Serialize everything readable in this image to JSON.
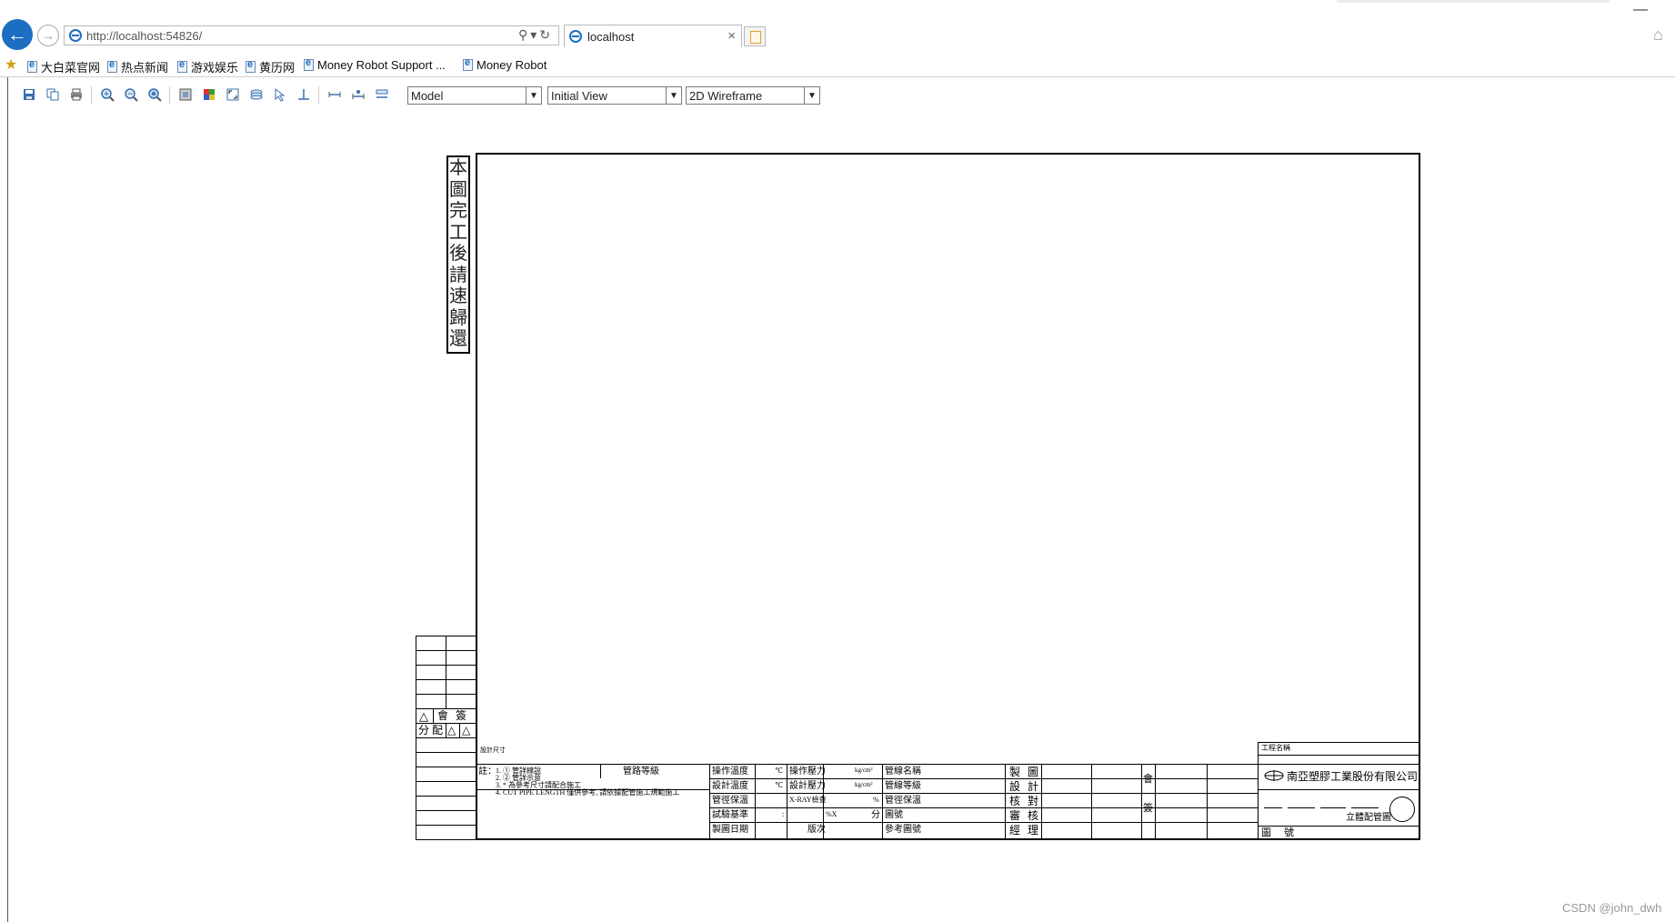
{
  "browser": {
    "url": "http://localhost:54826/",
    "tab_title": "localhost",
    "favorites": [
      "大白菜官网",
      "热点新闻",
      "游戏娱乐",
      "黄历网",
      "Money Robot Support ...",
      "Money Robot"
    ]
  },
  "cad_viewer": {
    "toolbar_icons": [
      "save-icon",
      "copy-icon",
      "print-icon",
      "zoom-in-icon",
      "zoom-out-icon",
      "zoom-realtime-icon",
      "layer-icon",
      "color-icon",
      "zoom-extents-icon",
      "layers-list-icon",
      "select-icon",
      "ortho-icon",
      "measure-icon",
      "measure-point-icon",
      "measure-area-icon"
    ],
    "layout_select": "Model",
    "view_select": "Initial View",
    "visual_style_select": "2D Wireframe"
  },
  "drawing": {
    "vertical_note": [
      "本",
      "圖",
      "完",
      "工",
      "後",
      "請",
      "速",
      "歸",
      "還"
    ],
    "revision_header": {
      "symbol": "△",
      "col1": "會",
      "col2": "簽"
    },
    "revision_row2": {
      "col1": "分",
      "col2": "配",
      "col3": "△",
      "col4": "△"
    },
    "notes_label": "註：",
    "notes": [
      "1. ① 管詳線說",
      "2. ② 管詳示意",
      "3. * 為參考尺寸請配合施工",
      "4. CUT PIPE LENGTH 僅供參考, 請依據配管施工規範施工"
    ],
    "small_label_top": "設計尺寸",
    "pipe_class_label": "管路等級",
    "props_col1": [
      "操作溫度",
      "設計溫度",
      "管徑保溫",
      "試驗基準",
      "製圖日期"
    ],
    "props_col2": [
      "操作壓力",
      "設計壓力",
      "X-RAY檢查",
      "",
      "版次"
    ],
    "props_col2_marks": [
      "℃",
      "℃",
      "",
      ":"
    ],
    "props_col3_marks": [
      "kg/cm²",
      "kg/cm²",
      "%",
      "%X",
      "分"
    ],
    "props_col4": [
      "管線名稱",
      "管線等級",
      "管徑保溫",
      "圖號",
      "參考圖號"
    ],
    "approval": [
      "製圖",
      "設計",
      "核對",
      "審核",
      "經理"
    ],
    "meeting_label": [
      "會",
      "簽"
    ],
    "company_name": "南亞塑膠工業股份有限公司",
    "title_header": "工程名稱",
    "drawing_title": "立體配管圖",
    "drawing_number_label": "圖號"
  },
  "footer": {
    "watermark": "CSDN @john_dwh"
  }
}
